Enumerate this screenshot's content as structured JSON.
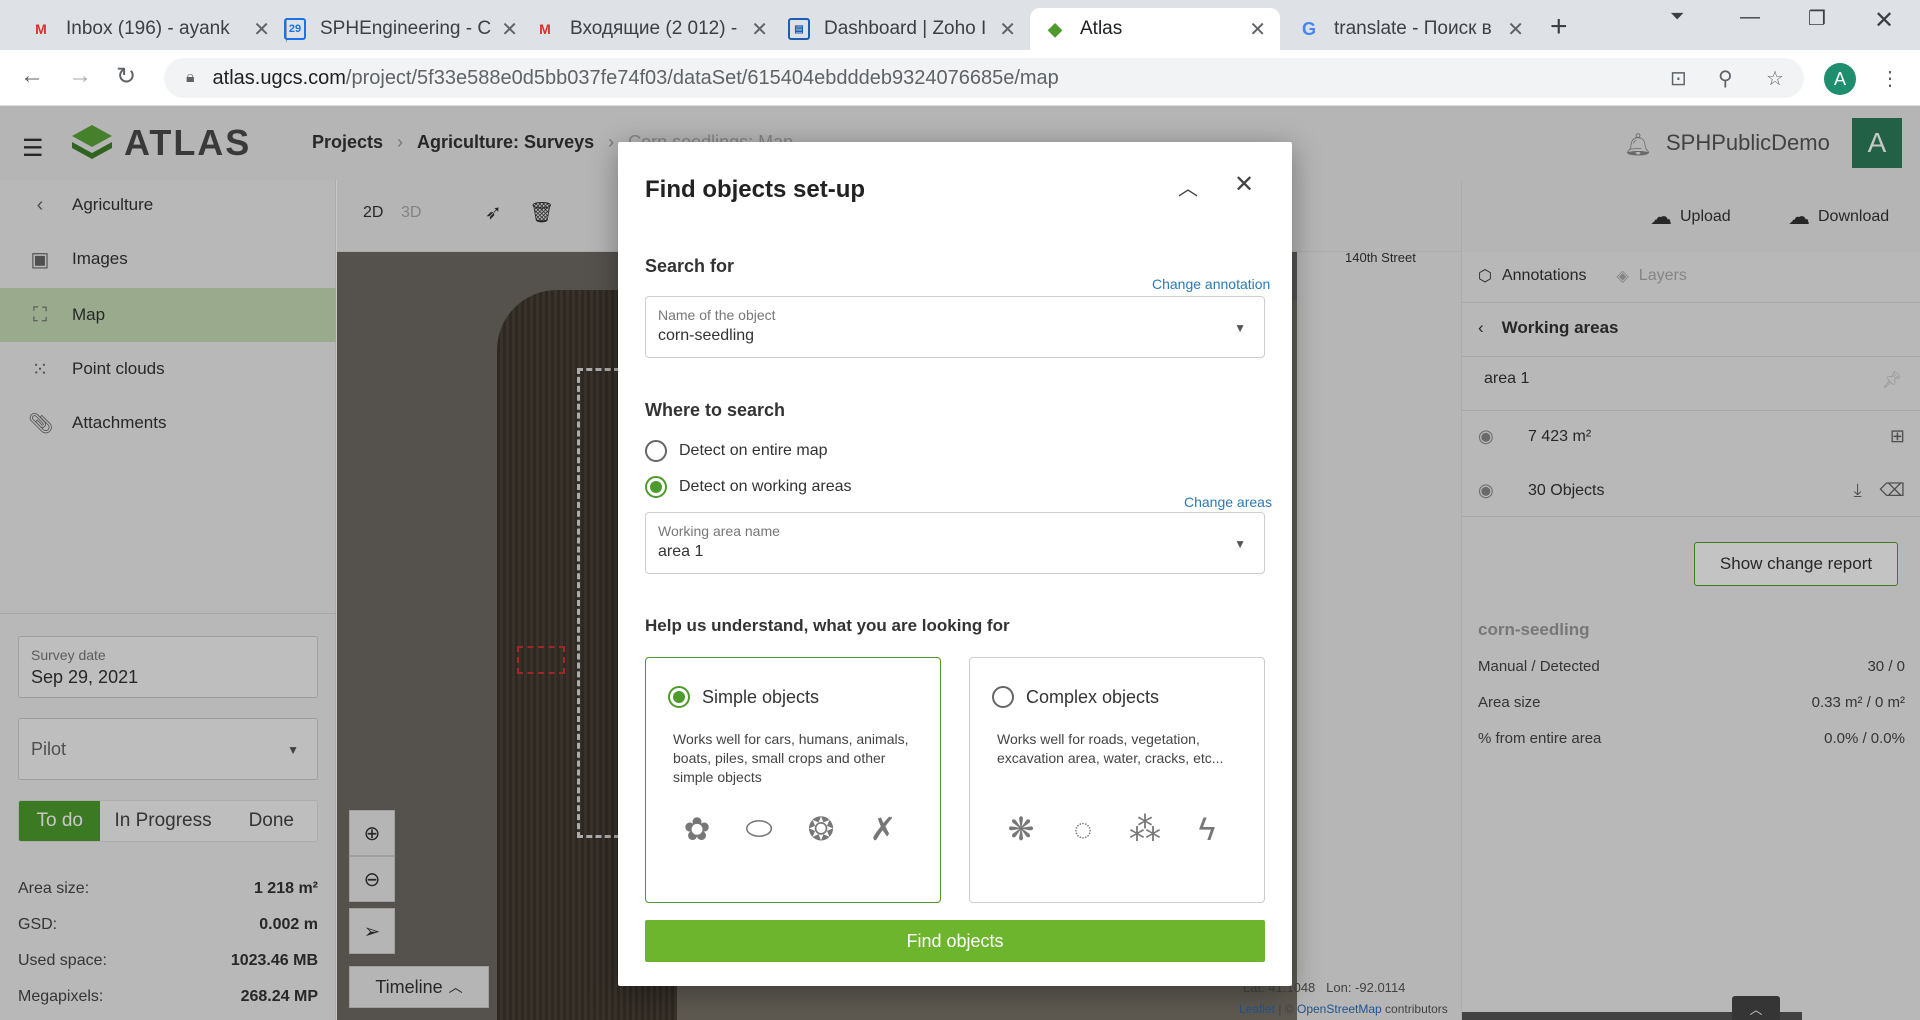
{
  "browser": {
    "tabs": [
      {
        "title": "Inbox (196) - ayank",
        "icon": "gmail-icon"
      },
      {
        "title": "SPHEngineering - C",
        "icon": "calendar-icon",
        "badge": "29"
      },
      {
        "title": "Входящие (2 012) -",
        "icon": "gmail-icon"
      },
      {
        "title": "Dashboard | Zoho I",
        "icon": "zoho-icon"
      },
      {
        "title": "Atlas",
        "icon": "atlas-icon"
      },
      {
        "title": "translate - Поиск в",
        "icon": "google-icon"
      }
    ],
    "url_host": "atlas.ugcs.com",
    "url_path": "/project/5f33e588e0d5bb037fe74f03/dataSet/615404ebdddeb9324076685e/map",
    "profile_initial": "A"
  },
  "app": {
    "logo_text": "ATLAS",
    "breadcrumbs": [
      "Projects",
      "Agriculture: Surveys",
      "Corn seedlings: Map"
    ],
    "org_name": "SPHPublicDemo",
    "avatar_initial": "A"
  },
  "sidebar": {
    "back_label": "Agriculture",
    "items": [
      {
        "label": "Images",
        "icon": "images-icon"
      },
      {
        "label": "Map",
        "icon": "map-icon",
        "active": true
      },
      {
        "label": "Point clouds",
        "icon": "point-cloud-icon"
      },
      {
        "label": "Attachments",
        "icon": "paperclip-icon"
      }
    ],
    "survey_date_label": "Survey date",
    "survey_date": "Sep 29, 2021",
    "pilot_placeholder": "Pilot",
    "status_tabs": [
      "To do",
      "In Progress",
      "Done"
    ],
    "stats": [
      {
        "label": "Area size:",
        "value": "1 218 m²"
      },
      {
        "label": "GSD:",
        "value": "0.002 m"
      },
      {
        "label": "Used space:",
        "value": "1023.46 MB"
      },
      {
        "label": "Megapixels:",
        "value": "268.24 MP"
      }
    ]
  },
  "map": {
    "mode_2d": "2D",
    "mode_3d": "3D",
    "street_label": "140th Street",
    "timeline_label": "Timeline",
    "lat_label": "Lat: 41.1048",
    "lon_label": "Lon: -92.0114",
    "attrib_leaflet": "Leaflet",
    "attrib_sep": " | © ",
    "attrib_osm": "OpenStreetMap",
    "attrib_tail": " contributors"
  },
  "right_panel": {
    "upload_label": "Upload",
    "download_label": "Download",
    "tab_annotations": "Annotations",
    "tab_layers": "Layers",
    "section_title": "Working areas",
    "area_name": "area 1",
    "area_size": "7 423 m²",
    "objects_count": "30 Objects",
    "report_button": "Show change report",
    "class_name": "corn-seedling",
    "kv": [
      {
        "label": "Manual / Detected",
        "value": "30 / 0"
      },
      {
        "label": "Area size",
        "value": "0.33 m² / 0 m²"
      },
      {
        "label": "% from entire area",
        "value": "0.0% / 0.0%"
      }
    ]
  },
  "modal": {
    "title": "Find objects set-up",
    "search_for_label": "Search for",
    "change_annotation_link": "Change annotation",
    "object_field_label": "Name of the object",
    "object_field_value": "corn-seedling",
    "where_label": "Where to search",
    "radio_entire_map": "Detect on entire map",
    "radio_working_areas": "Detect on working areas",
    "change_areas_link": "Change areas",
    "area_field_label": "Working area name",
    "area_field_value": "area 1",
    "help_label": "Help us understand, what you are looking for",
    "simple_title": "Simple objects",
    "simple_desc": "Works well for cars, humans, animals, boats, piles, small crops and other simple objects",
    "complex_title": "Complex objects",
    "complex_desc": "Works well for roads, vegetation, excavation area, water, cracks, etc...",
    "find_button": "Find objects"
  },
  "colors": {
    "accent_green": "#6cb52d",
    "active_nav": "#c5dcb4",
    "link_blue": "#2a7ab8"
  }
}
